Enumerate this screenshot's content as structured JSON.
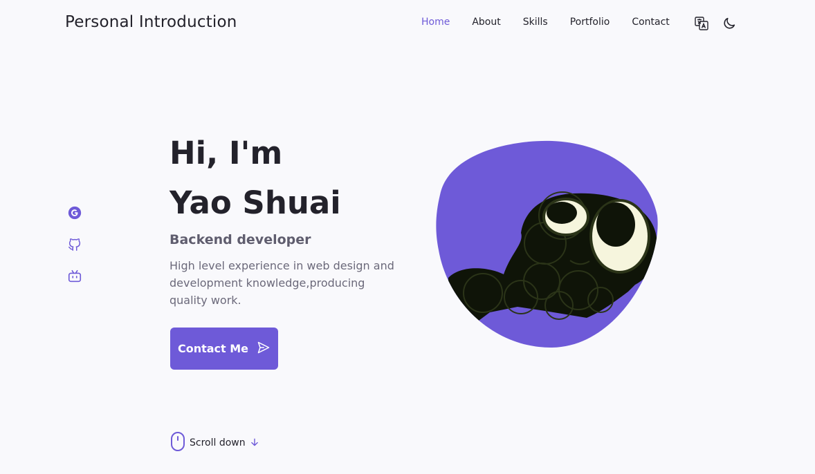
{
  "header": {
    "logo": "Personal Introduction",
    "nav": [
      {
        "label": "Home",
        "active": true
      },
      {
        "label": "About",
        "active": false
      },
      {
        "label": "Skills",
        "active": false
      },
      {
        "label": "Portfolio",
        "active": false
      },
      {
        "label": "Contact",
        "active": false
      }
    ],
    "icons": [
      "translate-icon",
      "moon-icon"
    ]
  },
  "social": [
    "google-icon",
    "github-icon",
    "bilibili-icon"
  ],
  "hero": {
    "greeting": "Hi, I'm",
    "name": "Yao Shuai",
    "role": "Backend developer",
    "description": "High level experience in web design and development knowledge,producing quality work.",
    "cta_label": "Contact Me"
  },
  "scroll": {
    "label": "Scroll down"
  },
  "colors": {
    "accent": "#6e5ad8",
    "text": "#23222b",
    "muted": "#6b697a",
    "background": "#f9f9fc"
  }
}
